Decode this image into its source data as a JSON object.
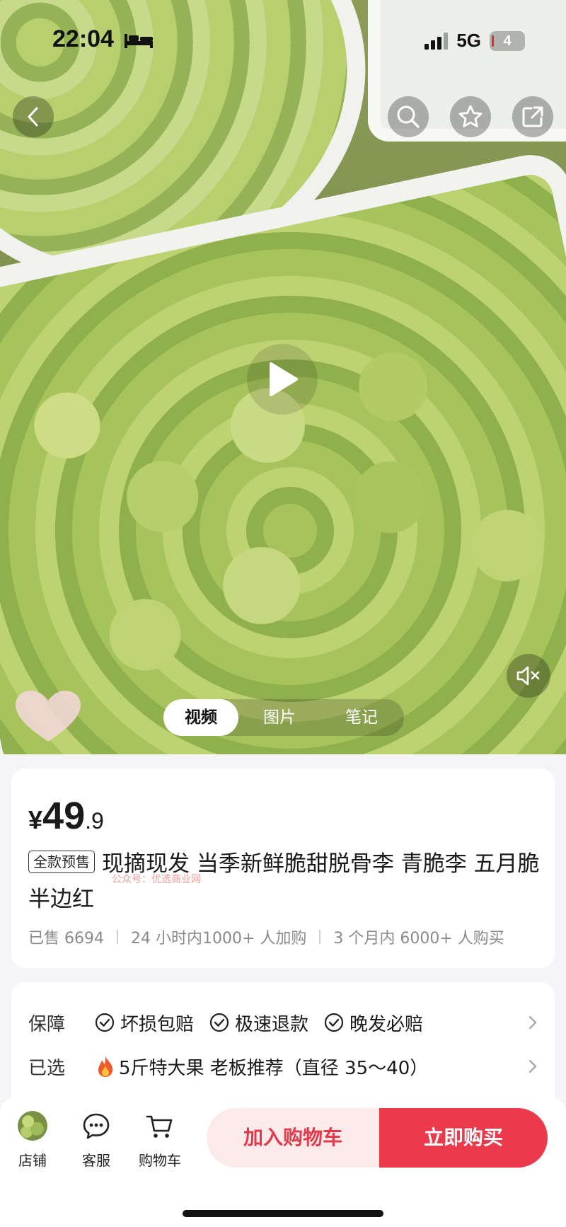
{
  "status_bar": {
    "time": "22:04",
    "network": "5G",
    "battery": "4"
  },
  "media": {
    "tabs": [
      "视频",
      "图片",
      "笔记"
    ],
    "active_tab": "视频"
  },
  "product": {
    "price_symbol": "¥",
    "price_int": "49",
    "price_dec": ".9",
    "presale_tag": "全款预售",
    "title": "现摘现发 当季新鲜脆甜脱骨李 青脆李 五月脆 半边红",
    "watermark": "公众号：优选商业网",
    "stats": [
      "已售 6694",
      "24 小时内1000+ 人加购",
      "3 个月内 6000+ 人购买"
    ]
  },
  "guarantee": {
    "label": "保障",
    "items": [
      "坏损包赔",
      "极速退款",
      "晚发必赔"
    ]
  },
  "selected": {
    "label": "已选",
    "value": "5斤特大果 老板推荐（直径 35～40）"
  },
  "bottom_bar": {
    "shop": "店铺",
    "service": "客服",
    "cart": "购物车",
    "add_to_cart": "加入购物车",
    "buy_now": "立即购买"
  },
  "colors": {
    "accent": "#ea3a4b",
    "accent_light": "#fdebec"
  },
  "icons": [
    "back-icon",
    "search-icon",
    "star-icon",
    "share-icon",
    "play-icon",
    "mute-icon",
    "check-icon",
    "fire-icon",
    "chevron-right-icon",
    "chat-icon",
    "cart-icon"
  ]
}
